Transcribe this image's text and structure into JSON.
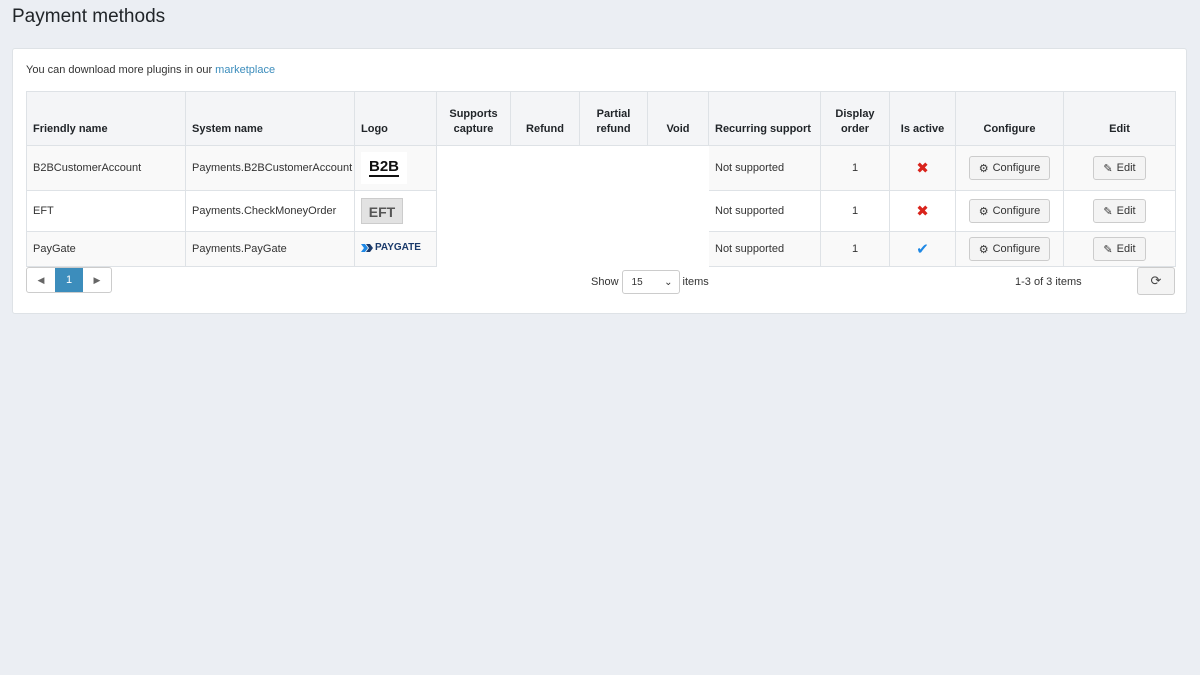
{
  "page": {
    "title": "Payment methods"
  },
  "notice": {
    "text": "You can download more plugins in our ",
    "link": "marketplace"
  },
  "table": {
    "headers": {
      "friendly_name": "Friendly name",
      "system_name": "System name",
      "logo": "Logo",
      "supports_capture_1": "Supports",
      "supports_capture_2": "capture",
      "refund": "Refund",
      "partial_refund_1": "Partial",
      "partial_refund_2": "refund",
      "void": "Void",
      "recurring": "Recurring support",
      "display_order_1": "Display",
      "display_order_2": "order",
      "is_active": "Is active",
      "configure": "Configure",
      "edit": "Edit"
    },
    "rows": [
      {
        "friendly": "B2BCustomerAccount",
        "system": "Payments.B2BCustomerAccount",
        "logo_text": "B2B",
        "recurring": "Not supported",
        "order": "1",
        "active": false,
        "configure": "Configure",
        "edit": "Edit"
      },
      {
        "friendly": "EFT",
        "system": "Payments.CheckMoneyOrder",
        "logo_text": "EFT",
        "recurring": "Not supported",
        "order": "1",
        "active": false,
        "configure": "Configure",
        "edit": "Edit"
      },
      {
        "friendly": "PayGate",
        "system": "Payments.PayGate",
        "logo_text": "PAYGATE",
        "recurring": "Not supported",
        "order": "1",
        "active": true,
        "configure": "Configure",
        "edit": "Edit"
      }
    ]
  },
  "pager": {
    "prev_icon": "triangle-left-icon",
    "current_page": "1",
    "next_icon": "triangle-right-icon",
    "show_label": "Show",
    "page_size": "15",
    "items_label": "items",
    "summary": "1-3 of 3 items",
    "refresh_icon": "refresh-icon"
  },
  "colors": {
    "accent": "#3c8dbc",
    "inactive": "#d9241c",
    "active": "#1e88e5"
  }
}
